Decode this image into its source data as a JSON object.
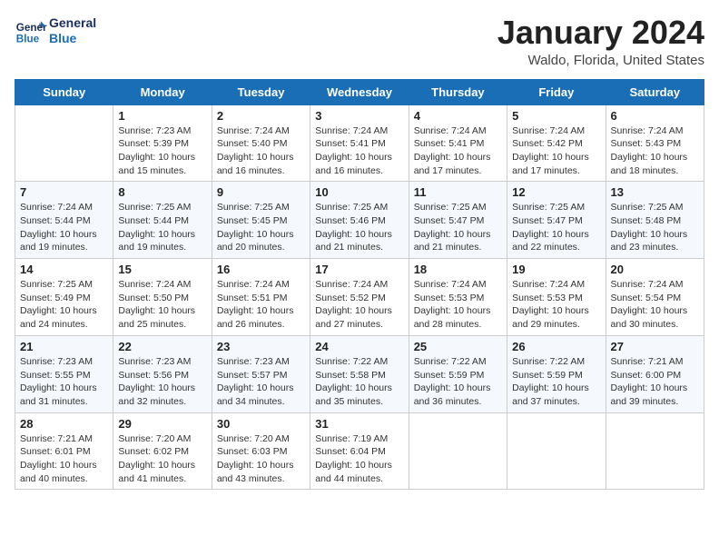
{
  "header": {
    "logo_line1": "General",
    "logo_line2": "Blue",
    "month": "January 2024",
    "location": "Waldo, Florida, United States"
  },
  "days_of_week": [
    "Sunday",
    "Monday",
    "Tuesday",
    "Wednesday",
    "Thursday",
    "Friday",
    "Saturday"
  ],
  "weeks": [
    [
      {
        "day": "",
        "info": ""
      },
      {
        "day": "1",
        "info": "Sunrise: 7:23 AM\nSunset: 5:39 PM\nDaylight: 10 hours\nand 15 minutes."
      },
      {
        "day": "2",
        "info": "Sunrise: 7:24 AM\nSunset: 5:40 PM\nDaylight: 10 hours\nand 16 minutes."
      },
      {
        "day": "3",
        "info": "Sunrise: 7:24 AM\nSunset: 5:41 PM\nDaylight: 10 hours\nand 16 minutes."
      },
      {
        "day": "4",
        "info": "Sunrise: 7:24 AM\nSunset: 5:41 PM\nDaylight: 10 hours\nand 17 minutes."
      },
      {
        "day": "5",
        "info": "Sunrise: 7:24 AM\nSunset: 5:42 PM\nDaylight: 10 hours\nand 17 minutes."
      },
      {
        "day": "6",
        "info": "Sunrise: 7:24 AM\nSunset: 5:43 PM\nDaylight: 10 hours\nand 18 minutes."
      }
    ],
    [
      {
        "day": "7",
        "info": "Sunrise: 7:24 AM\nSunset: 5:44 PM\nDaylight: 10 hours\nand 19 minutes."
      },
      {
        "day": "8",
        "info": "Sunrise: 7:25 AM\nSunset: 5:44 PM\nDaylight: 10 hours\nand 19 minutes."
      },
      {
        "day": "9",
        "info": "Sunrise: 7:25 AM\nSunset: 5:45 PM\nDaylight: 10 hours\nand 20 minutes."
      },
      {
        "day": "10",
        "info": "Sunrise: 7:25 AM\nSunset: 5:46 PM\nDaylight: 10 hours\nand 21 minutes."
      },
      {
        "day": "11",
        "info": "Sunrise: 7:25 AM\nSunset: 5:47 PM\nDaylight: 10 hours\nand 21 minutes."
      },
      {
        "day": "12",
        "info": "Sunrise: 7:25 AM\nSunset: 5:47 PM\nDaylight: 10 hours\nand 22 minutes."
      },
      {
        "day": "13",
        "info": "Sunrise: 7:25 AM\nSunset: 5:48 PM\nDaylight: 10 hours\nand 23 minutes."
      }
    ],
    [
      {
        "day": "14",
        "info": "Sunrise: 7:25 AM\nSunset: 5:49 PM\nDaylight: 10 hours\nand 24 minutes."
      },
      {
        "day": "15",
        "info": "Sunrise: 7:24 AM\nSunset: 5:50 PM\nDaylight: 10 hours\nand 25 minutes."
      },
      {
        "day": "16",
        "info": "Sunrise: 7:24 AM\nSunset: 5:51 PM\nDaylight: 10 hours\nand 26 minutes."
      },
      {
        "day": "17",
        "info": "Sunrise: 7:24 AM\nSunset: 5:52 PM\nDaylight: 10 hours\nand 27 minutes."
      },
      {
        "day": "18",
        "info": "Sunrise: 7:24 AM\nSunset: 5:53 PM\nDaylight: 10 hours\nand 28 minutes."
      },
      {
        "day": "19",
        "info": "Sunrise: 7:24 AM\nSunset: 5:53 PM\nDaylight: 10 hours\nand 29 minutes."
      },
      {
        "day": "20",
        "info": "Sunrise: 7:24 AM\nSunset: 5:54 PM\nDaylight: 10 hours\nand 30 minutes."
      }
    ],
    [
      {
        "day": "21",
        "info": "Sunrise: 7:23 AM\nSunset: 5:55 PM\nDaylight: 10 hours\nand 31 minutes."
      },
      {
        "day": "22",
        "info": "Sunrise: 7:23 AM\nSunset: 5:56 PM\nDaylight: 10 hours\nand 32 minutes."
      },
      {
        "day": "23",
        "info": "Sunrise: 7:23 AM\nSunset: 5:57 PM\nDaylight: 10 hours\nand 34 minutes."
      },
      {
        "day": "24",
        "info": "Sunrise: 7:22 AM\nSunset: 5:58 PM\nDaylight: 10 hours\nand 35 minutes."
      },
      {
        "day": "25",
        "info": "Sunrise: 7:22 AM\nSunset: 5:59 PM\nDaylight: 10 hours\nand 36 minutes."
      },
      {
        "day": "26",
        "info": "Sunrise: 7:22 AM\nSunset: 5:59 PM\nDaylight: 10 hours\nand 37 minutes."
      },
      {
        "day": "27",
        "info": "Sunrise: 7:21 AM\nSunset: 6:00 PM\nDaylight: 10 hours\nand 39 minutes."
      }
    ],
    [
      {
        "day": "28",
        "info": "Sunrise: 7:21 AM\nSunset: 6:01 PM\nDaylight: 10 hours\nand 40 minutes."
      },
      {
        "day": "29",
        "info": "Sunrise: 7:20 AM\nSunset: 6:02 PM\nDaylight: 10 hours\nand 41 minutes."
      },
      {
        "day": "30",
        "info": "Sunrise: 7:20 AM\nSunset: 6:03 PM\nDaylight: 10 hours\nand 43 minutes."
      },
      {
        "day": "31",
        "info": "Sunrise: 7:19 AM\nSunset: 6:04 PM\nDaylight: 10 hours\nand 44 minutes."
      },
      {
        "day": "",
        "info": ""
      },
      {
        "day": "",
        "info": ""
      },
      {
        "day": "",
        "info": ""
      }
    ]
  ]
}
